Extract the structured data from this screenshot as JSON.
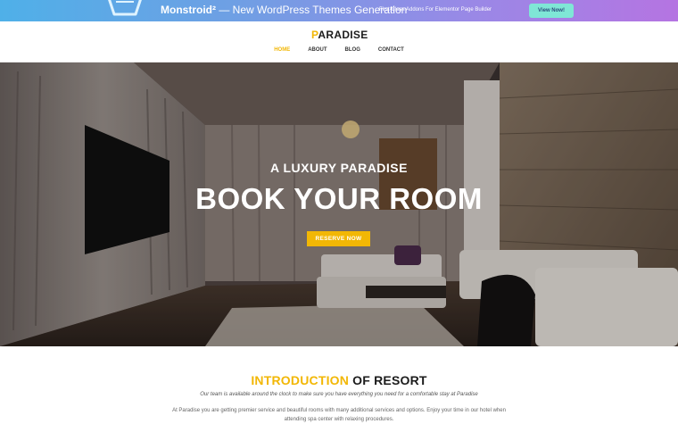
{
  "promo": {
    "title_bold": "Monstroid²",
    "title_rest": "— New WordPress Themes Generation",
    "subtitle": "First-Class Addons For Elementor Page Builder",
    "button_label": "View Now!"
  },
  "header": {
    "logo_mark": "P",
    "logo_rest": "ARADISE",
    "nav": [
      {
        "label": "HOME",
        "active": true
      },
      {
        "label": "ABOUT",
        "active": false
      },
      {
        "label": "BLOG",
        "active": false
      },
      {
        "label": "CONTACT",
        "active": false
      }
    ]
  },
  "hero": {
    "eyebrow": "A LUXURY PARADISE",
    "title": "BOOK YOUR ROOM",
    "button_label": "RESERVE NOW"
  },
  "intro": {
    "title_accent": "INTRODUCTION",
    "title_rest": " OF RESORT",
    "lead": "Our team is available around the clock to make sure you have everything you need for a comfortable stay at Paradise",
    "body": "At Paradise you are getting premier service and beautiful rooms with many additional services and options. Enjoy your time in our hotel when attending spa center with relaxing procedures."
  },
  "colors": {
    "accent": "#f2b705",
    "promo_button": "#7fe6d6"
  }
}
